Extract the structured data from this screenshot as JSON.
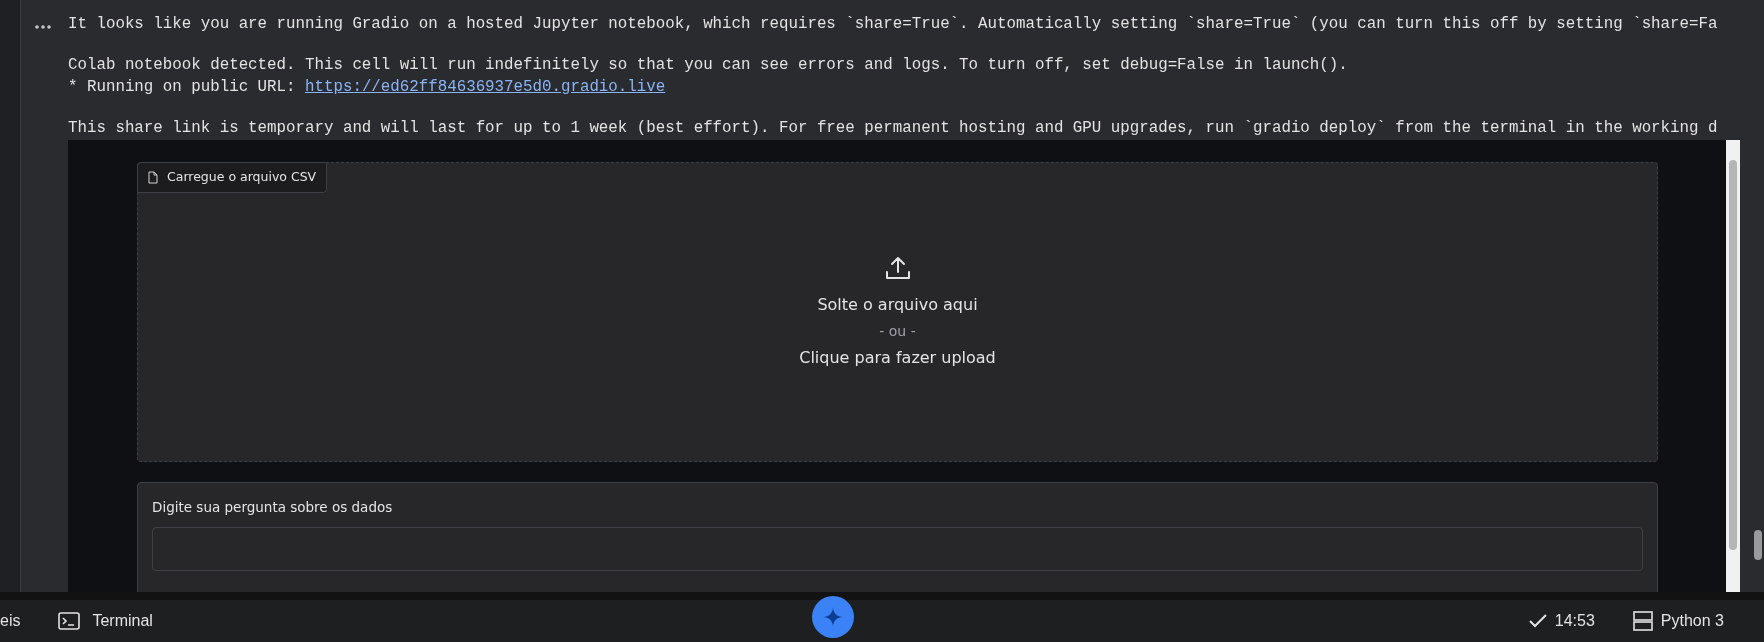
{
  "output": {
    "paragraphs": [
      {
        "lines": [
          {
            "text": "It looks like you are running Gradio on a hosted Jupyter notebook, which requires `share=True`. Automatically setting `share=True` (you can turn this off by setting `share=Fa"
          }
        ]
      },
      {
        "lines": [
          {
            "text": "Colab notebook detected. This cell will run indefinitely so that you can see errors and logs. To turn off, set debug=False in launch()."
          },
          {
            "text": "* Running on public URL: ",
            "link": "https://ed62ff84636937e5d0.gradio.live"
          }
        ]
      },
      {
        "lines": [
          {
            "text": "This share link is temporary and will last for up to 1 week (best effort). For free permanent hosting and GPU upgrades, run `gradio deploy` from the terminal in the working d"
          }
        ]
      }
    ]
  },
  "app": {
    "upload": {
      "label": "Carregue o arquivo CSV",
      "drop_text": "Solte o arquivo aqui",
      "or_text": "- ou -",
      "click_text": "Clique para fazer upload"
    },
    "question": {
      "label": "Digite sua pergunta sobre os dados"
    }
  },
  "status_bar": {
    "left_tab": "eis",
    "terminal": "Terminal",
    "time": "14:53",
    "runtime": "Python 3"
  }
}
